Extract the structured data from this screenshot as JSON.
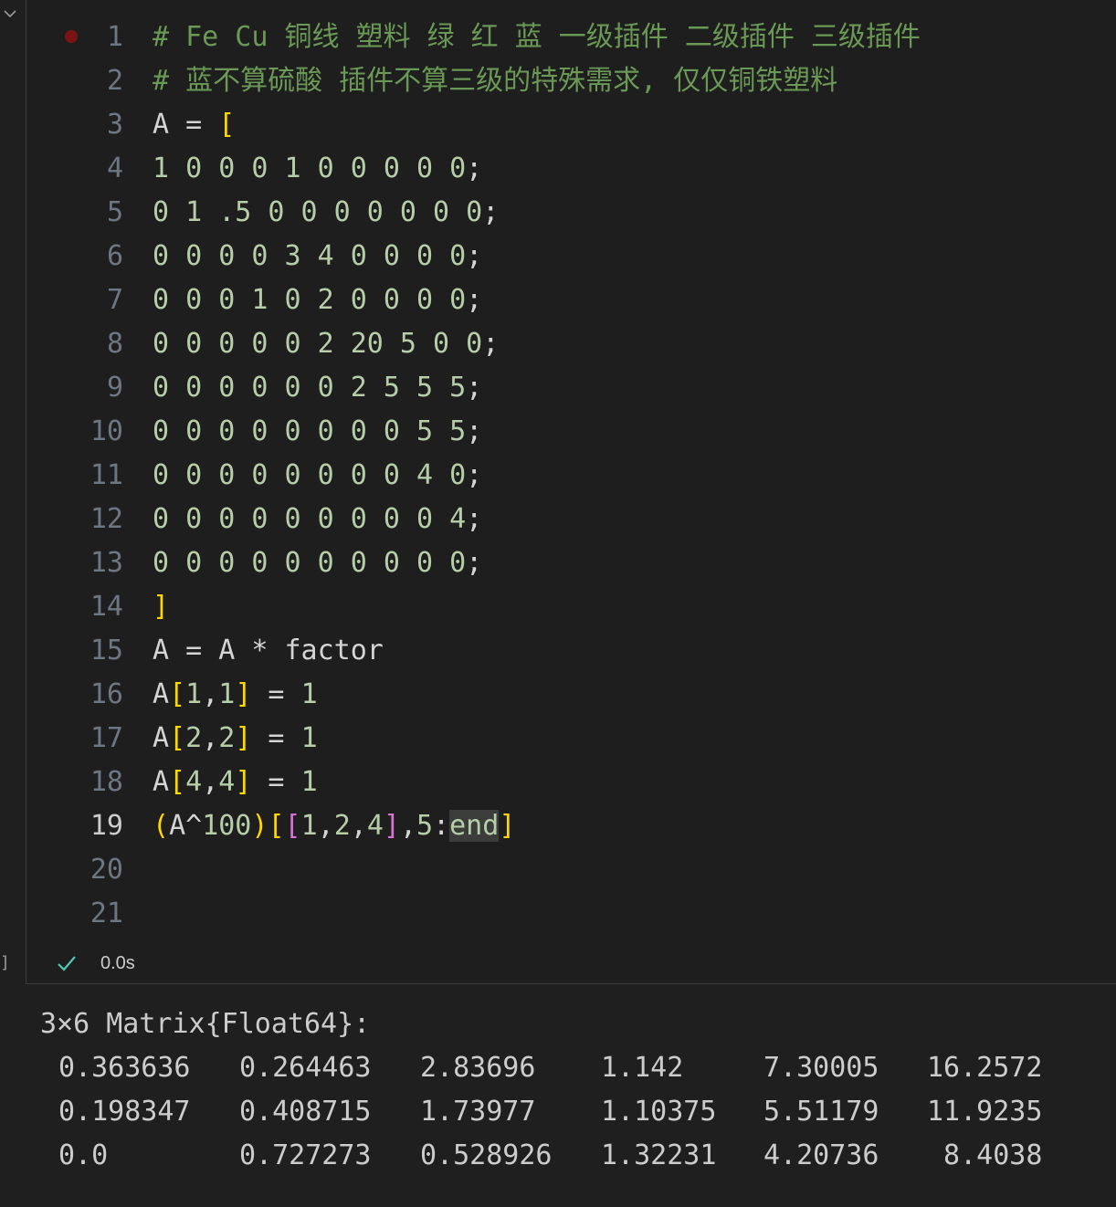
{
  "cell": {
    "status_time": "0.0s",
    "exec_count": "]",
    "lines": [
      {
        "n": "1",
        "tokens": [
          {
            "t": "# Fe Cu 铜线 塑料 绿 红 蓝 一级插件 二级插件 三级插件",
            "c": "comment"
          }
        ]
      },
      {
        "n": "2",
        "tokens": [
          {
            "t": "# 蓝不算硫酸 插件不算三级的特殊需求, 仅仅铜铁塑料",
            "c": "comment"
          }
        ]
      },
      {
        "n": "3",
        "tokens": [
          {
            "t": "A = ",
            "c": "id"
          },
          {
            "t": "[",
            "c": "b1"
          }
        ]
      },
      {
        "n": "4",
        "tokens": [
          {
            "t": "1 0 0 0 1 0 0 0 0 0",
            "c": "num"
          },
          {
            "t": ";",
            "c": "id"
          }
        ]
      },
      {
        "n": "5",
        "tokens": [
          {
            "t": "0 1 .5 0 0 0 0 0 0 0",
            "c": "num"
          },
          {
            "t": ";",
            "c": "id"
          }
        ]
      },
      {
        "n": "6",
        "tokens": [
          {
            "t": "0 0 0 0 3 4 0 0 0 0",
            "c": "num"
          },
          {
            "t": ";",
            "c": "id"
          }
        ]
      },
      {
        "n": "7",
        "tokens": [
          {
            "t": "0 0 0 1 0 2 0 0 0 0",
            "c": "num"
          },
          {
            "t": ";",
            "c": "id"
          }
        ]
      },
      {
        "n": "8",
        "tokens": [
          {
            "t": "0 0 0 0 0 2 20 5 0 0",
            "c": "num"
          },
          {
            "t": ";",
            "c": "id"
          }
        ]
      },
      {
        "n": "9",
        "tokens": [
          {
            "t": "0 0 0 0 0 0 2 5 5 5",
            "c": "num"
          },
          {
            "t": ";",
            "c": "id"
          }
        ]
      },
      {
        "n": "10",
        "tokens": [
          {
            "t": "0 0 0 0 0 0 0 0 5 5",
            "c": "num"
          },
          {
            "t": ";",
            "c": "id"
          }
        ]
      },
      {
        "n": "11",
        "tokens": [
          {
            "t": "0 0 0 0 0 0 0 0 4 0",
            "c": "num"
          },
          {
            "t": ";",
            "c": "id"
          }
        ]
      },
      {
        "n": "12",
        "tokens": [
          {
            "t": "0 0 0 0 0 0 0 0 0 4",
            "c": "num"
          },
          {
            "t": ";",
            "c": "id"
          }
        ]
      },
      {
        "n": "13",
        "tokens": [
          {
            "t": "0 0 0 0 0 0 0 0 0 0",
            "c": "num"
          },
          {
            "t": ";",
            "c": "id"
          }
        ]
      },
      {
        "n": "14",
        "tokens": [
          {
            "t": "]",
            "c": "b1"
          }
        ]
      },
      {
        "n": "15",
        "tokens": [
          {
            "t": "A = A * factor",
            "c": "id"
          }
        ]
      },
      {
        "n": "16",
        "tokens": [
          {
            "t": "A",
            "c": "id"
          },
          {
            "t": "[",
            "c": "b1"
          },
          {
            "t": "1",
            "c": "num"
          },
          {
            "t": ",",
            "c": "id"
          },
          {
            "t": "1",
            "c": "num"
          },
          {
            "t": "]",
            "c": "b1"
          },
          {
            "t": " = ",
            "c": "id"
          },
          {
            "t": "1",
            "c": "num"
          }
        ]
      },
      {
        "n": "17",
        "tokens": [
          {
            "t": "A",
            "c": "id"
          },
          {
            "t": "[",
            "c": "b1"
          },
          {
            "t": "2",
            "c": "num"
          },
          {
            "t": ",",
            "c": "id"
          },
          {
            "t": "2",
            "c": "num"
          },
          {
            "t": "]",
            "c": "b1"
          },
          {
            "t": " = ",
            "c": "id"
          },
          {
            "t": "1",
            "c": "num"
          }
        ]
      },
      {
        "n": "18",
        "tokens": [
          {
            "t": "A",
            "c": "id"
          },
          {
            "t": "[",
            "c": "b1"
          },
          {
            "t": "4",
            "c": "num"
          },
          {
            "t": ",",
            "c": "id"
          },
          {
            "t": "4",
            "c": "num"
          },
          {
            "t": "]",
            "c": "b1"
          },
          {
            "t": " = ",
            "c": "id"
          },
          {
            "t": "1",
            "c": "num"
          }
        ]
      },
      {
        "n": "19",
        "active": true,
        "tokens": [
          {
            "t": "(",
            "c": "b1"
          },
          {
            "t": "A^",
            "c": "id"
          },
          {
            "t": "100",
            "c": "num"
          },
          {
            "t": ")",
            "c": "b1"
          },
          {
            "t": "[",
            "c": "b1"
          },
          {
            "t": "[",
            "c": "b2"
          },
          {
            "t": "1",
            "c": "num"
          },
          {
            "t": ",",
            "c": "id"
          },
          {
            "t": "2",
            "c": "num"
          },
          {
            "t": ",",
            "c": "id"
          },
          {
            "t": "4",
            "c": "num"
          },
          {
            "t": "]",
            "c": "b2"
          },
          {
            "t": ",",
            "c": "id"
          },
          {
            "t": "5",
            "c": "num"
          },
          {
            "t": ":",
            "c": "id"
          },
          {
            "t": "end",
            "c": "hl"
          },
          {
            "t": "]",
            "c": "b1"
          }
        ]
      },
      {
        "n": "20",
        "tokens": []
      },
      {
        "n": "21",
        "tokens": []
      }
    ]
  },
  "output": {
    "header": "3×6 Matrix{Float64}:",
    "rows": [
      [
        "0.363636",
        "0.264463",
        "2.83696",
        "1.142",
        "7.30005",
        "16.2572"
      ],
      [
        "0.198347",
        "0.408715",
        "1.73977",
        "1.10375",
        "5.51179",
        "11.9235"
      ],
      [
        "0.0",
        "0.727273",
        "0.528926",
        "1.32231",
        "4.20736",
        " 8.4038"
      ]
    ]
  },
  "colors": {
    "comment": "#6a9955",
    "number": "#b5cea8",
    "bracket1": "#ffd700",
    "bracket2": "#da70d6",
    "check": "#4ec9b0",
    "breakpoint": "#7a1313"
  }
}
